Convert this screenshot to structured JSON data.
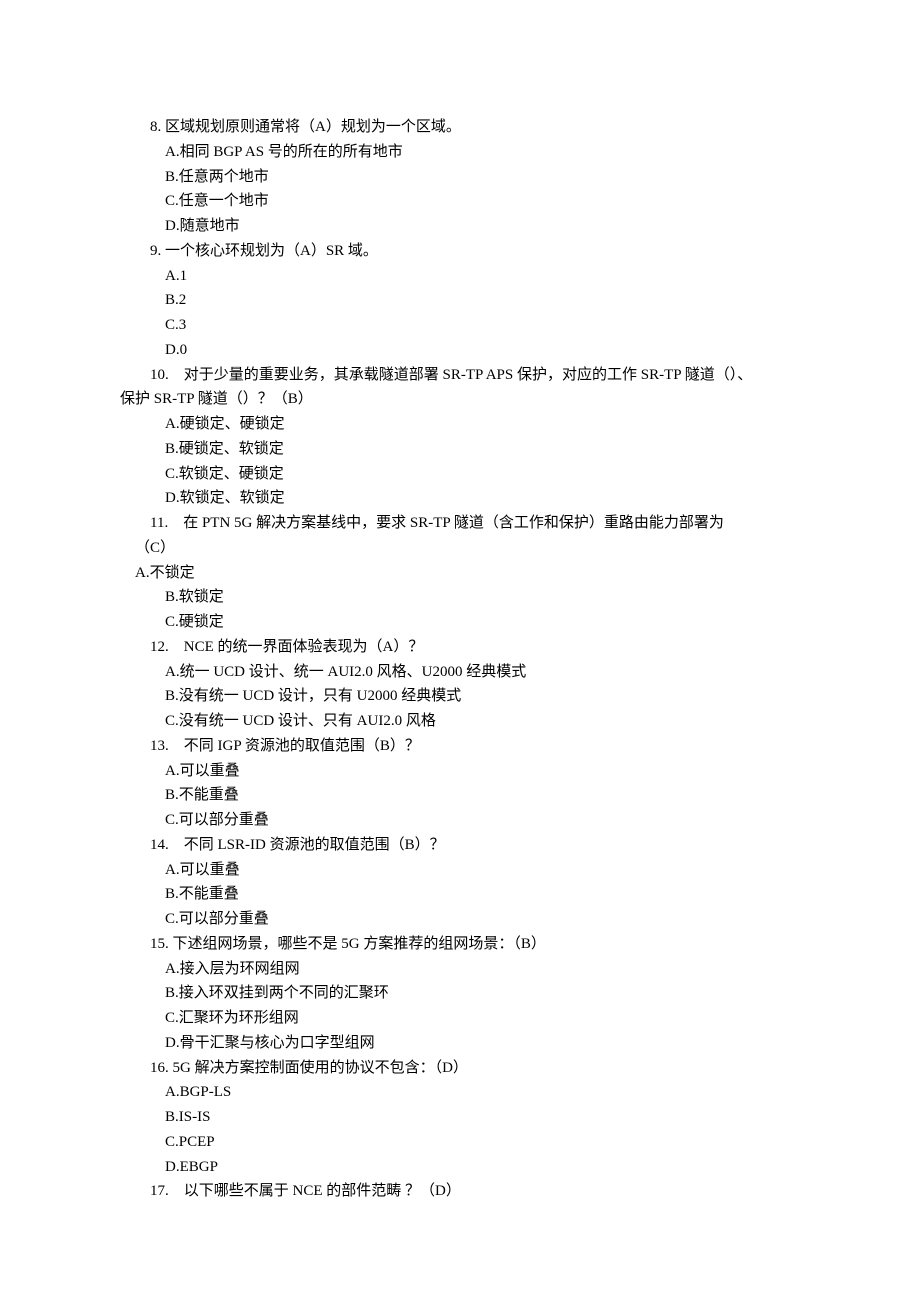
{
  "questions": [
    {
      "number": "8.",
      "stem": "区域规划原则通常将（A）规划为一个区域。",
      "options": [
        "A.相同 BGP AS 号的所在的所有地市",
        "B.任意两个地市",
        "C.任意一个地市",
        "D.随意地市"
      ]
    },
    {
      "number": "9.",
      "stem": "一个核心环规划为（A）SR 域。",
      "options": [
        "A.1",
        "B.2",
        "C.3",
        "D.0"
      ]
    },
    {
      "number": "10.",
      "stem": "对于少量的重要业务，其承载隧道部署 SR-TP APS 保护，对应的工作 SR-TP 隧道（）、",
      "stem_cont": "保护 SR-TP 隧道（）？（B）",
      "options": [
        "A.硬锁定、硬锁定",
        "B.硬锁定、软锁定",
        "C.软锁定、硬锁定",
        "D.软锁定、软锁定"
      ]
    },
    {
      "number": "11.",
      "stem": "在 PTN 5G 解决方案基线中，要求 SR-TP 隧道（含工作和保护）重路由能力部署为",
      "stem_cont": "（C）",
      "hang_option": "A.不锁定",
      "options": [
        "B.软锁定",
        "C.硬锁定"
      ]
    },
    {
      "number": "12.",
      "stem": "NCE 的统一界面体验表现为（A）？",
      "options": [
        "A.统一 UCD 设计、统一 AUI2.0 风格、U2000 经典模式",
        "B.没有统一 UCD 设计，只有 U2000 经典模式",
        "C.没有统一 UCD 设计、只有 AUI2.0 风格"
      ]
    },
    {
      "number": "13.",
      "stem": "不同 IGP 资源池的取值范围（B）？",
      "options": [
        "A.可以重叠",
        "B.不能重叠",
        "C.可以部分重叠"
      ]
    },
    {
      "number": "14.",
      "stem": "不同 LSR-ID 资源池的取值范围（B）？",
      "options": [
        "A.可以重叠",
        "B.不能重叠",
        "C.可以部分重叠"
      ]
    },
    {
      "number": "15.",
      "stem": "下述组网场景，哪些不是 5G 方案推荐的组网场景：（B）",
      "options": [
        "A.接入层为环网组网",
        "B.接入环双挂到两个不同的汇聚环",
        "C.汇聚环为环形组网",
        "D.骨干汇聚与核心为口字型组网"
      ]
    },
    {
      "number": "16.",
      "stem": "5G 解决方案控制面使用的协议不包含：（D）",
      "options": [
        "A.BGP-LS",
        "B.IS-IS",
        "C.PCEP",
        "D.EBGP"
      ]
    },
    {
      "number": "17.",
      "stem": "以下哪些不属于 NCE 的部件范畴 ？（D）",
      "options": []
    }
  ]
}
